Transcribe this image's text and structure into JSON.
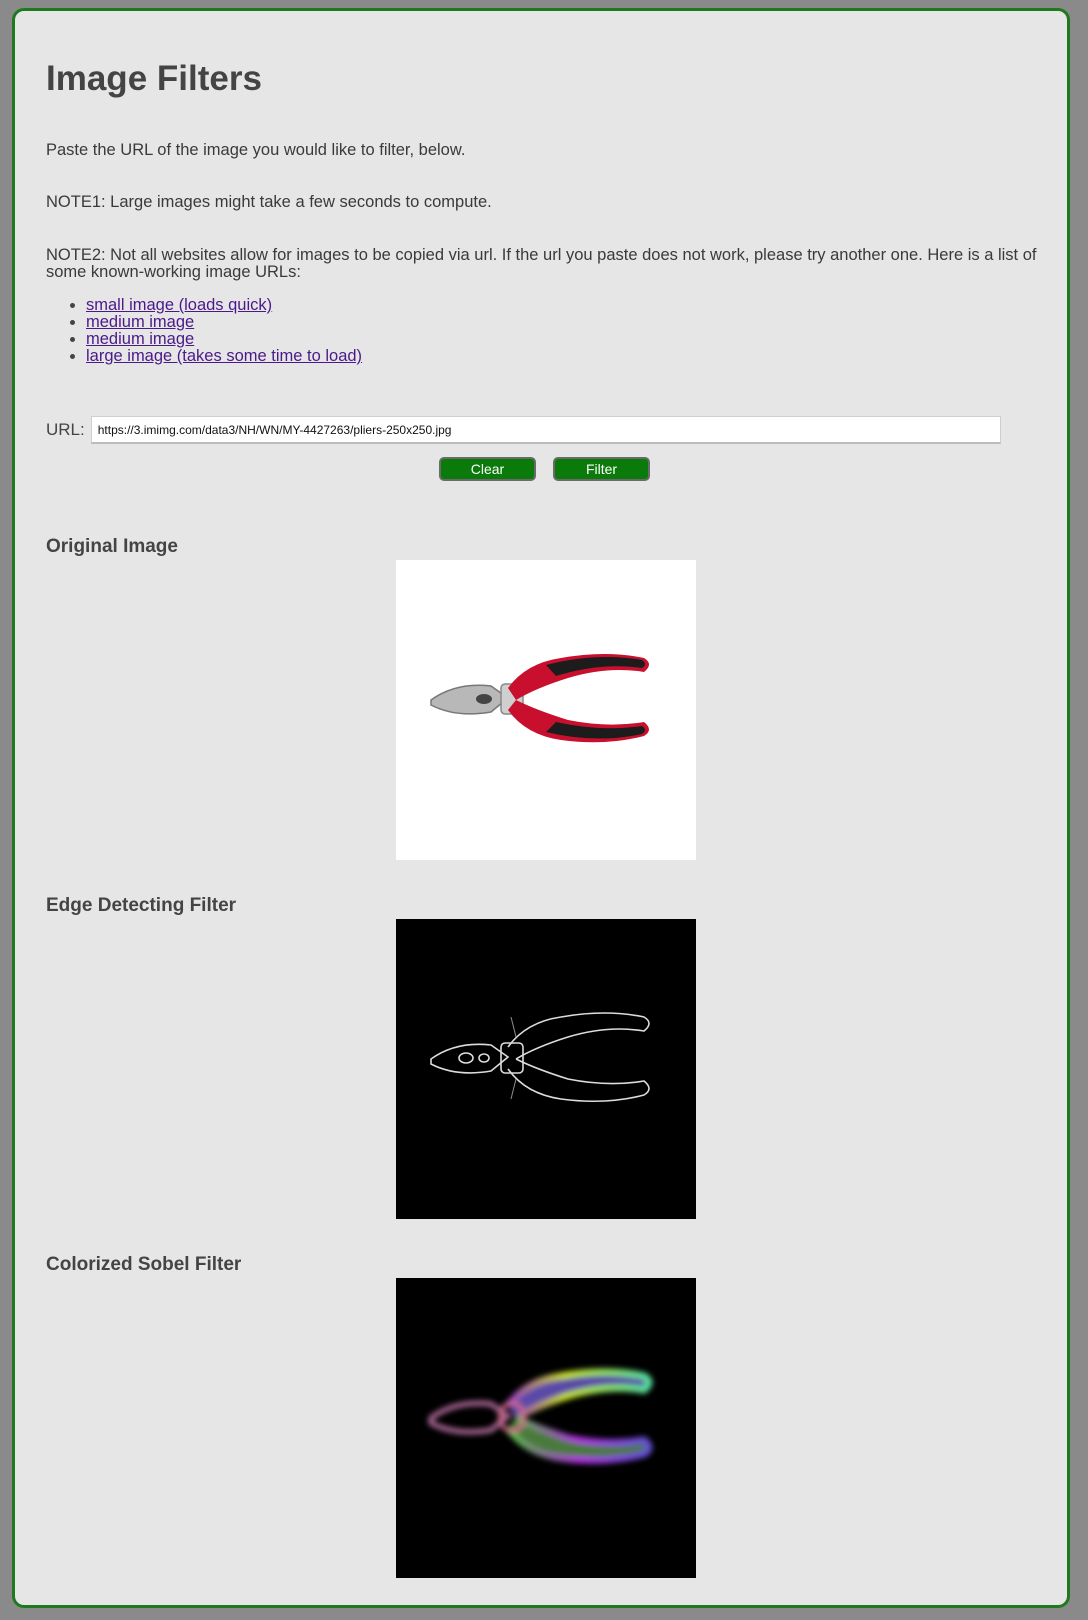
{
  "page": {
    "title": "Image Filters",
    "intro": "Paste the URL of the image you would like to filter, below.",
    "note1": "NOTE1: Large images might take a few seconds to compute.",
    "note2": "NOTE2: Not all websites allow for images to be copied via url. If the url you paste does not work, please try another one. Here is a list of some known-working image URLs:"
  },
  "links": [
    {
      "label": "small image (loads quick)"
    },
    {
      "label": "medium image"
    },
    {
      "label": "medium image"
    },
    {
      "label": "large image (takes some time to load)"
    }
  ],
  "form": {
    "url_label": "URL:",
    "url_value": "https://3.imimg.com/data3/NH/WN/MY-4427263/pliers-250x250.jpg",
    "clear_label": "Clear",
    "filter_label": "Filter"
  },
  "sections": {
    "original": "Original Image",
    "edge": "Edge Detecting Filter",
    "sobel": "Colorized Sobel Filter"
  },
  "colors": {
    "panel_border": "#1f7a1f",
    "button_bg": "#0a7a0a",
    "link": "#4b1a8a"
  }
}
